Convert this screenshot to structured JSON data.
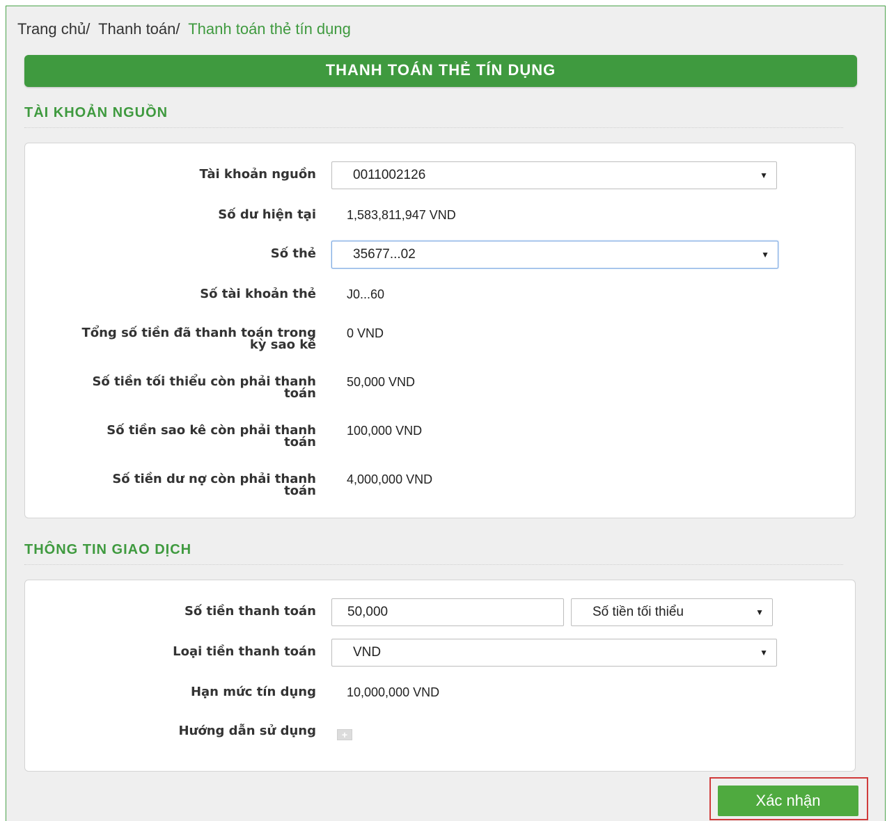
{
  "breadcrumb": {
    "home": "Trang chủ/",
    "payment": "Thanh toán/",
    "current": "Thanh toán thẻ tín dụng"
  },
  "page_title": "THANH TOÁN THẺ TÍN DỤNG",
  "source_section": {
    "title": "TÀI KHOẢN NGUỒN",
    "source_account_label": "Tài khoản nguồn",
    "source_account_value": "0011002126",
    "balance_label": "Số dư hiện tại",
    "balance_value": "1,583,811,947 VND",
    "card_label": "Số thẻ",
    "card_value": "35677...02",
    "card_account_label": "Số tài khoản thẻ",
    "card_account_value": "J0...60",
    "paid_label_line1": "Tổng số tiền đã thanh toán trong",
    "paid_label_line2": "kỳ sao kê",
    "paid_value": "0 VND",
    "min_label_line1": "Số tiền tối thiểu còn phải thanh",
    "min_label_line2": "toán",
    "min_value": "50,000 VND",
    "statement_label_line1": "Số tiền sao kê còn phải thanh",
    "statement_label_line2": "toán",
    "statement_value": "100,000 VND",
    "debt_label_line1": "Số tiền dư nợ còn phải thanh",
    "debt_label_line2": "toán",
    "debt_value": "4,000,000 VND"
  },
  "transaction_section": {
    "title": "THÔNG TIN GIAO DỊCH",
    "amount_label": "Số tiền thanh toán",
    "amount_value": "50,000",
    "amount_type_value": "Số tiền tối thiểu",
    "currency_label": "Loại tiền thanh toán",
    "currency_value": "VND",
    "credit_limit_label": "Hạn mức tín dụng",
    "credit_limit_value": "10,000,000 VND",
    "guide_label": "Hướng dẫn sử dụng"
  },
  "confirm_label": "Xác nhận",
  "icons": {
    "dropdown": "caret-down-icon",
    "expand": "plus-box-icon"
  },
  "colors": {
    "brand_green": "#3f9a3f",
    "button_green": "#4faa3f",
    "highlight_red": "#d03a3a"
  }
}
